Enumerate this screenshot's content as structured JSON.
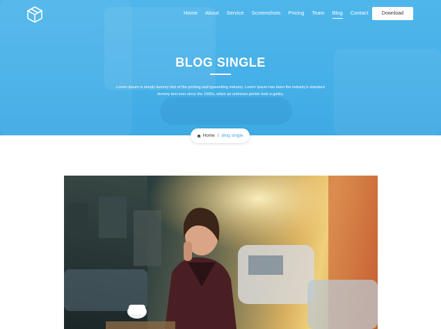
{
  "nav": {
    "items": [
      {
        "label": "Home",
        "active": false
      },
      {
        "label": "About",
        "active": false
      },
      {
        "label": "Service",
        "active": false
      },
      {
        "label": "Screenshots",
        "active": false
      },
      {
        "label": "Pricing",
        "active": false
      },
      {
        "label": "Team",
        "active": false
      },
      {
        "label": "Blog",
        "active": true
      },
      {
        "label": "Contact",
        "active": false
      }
    ],
    "download_label": "Download"
  },
  "hero": {
    "title": "BLOG SINGLE",
    "description": "Lorem Ipsum is simply dummy text of the printing and typesetting industry. Lorem Ipsum has been the industry's standard dummy text ever since the 1500s, when an unknown printer took a galley."
  },
  "breadcrumb": {
    "home_label": "Home",
    "separator": "/",
    "current_label": "blog single"
  },
  "colors": {
    "hero_blue": "#46b0e8",
    "accent": "#3da9e4"
  },
  "icons": {
    "logo": "cube-logo-icon",
    "home": "home-icon"
  }
}
